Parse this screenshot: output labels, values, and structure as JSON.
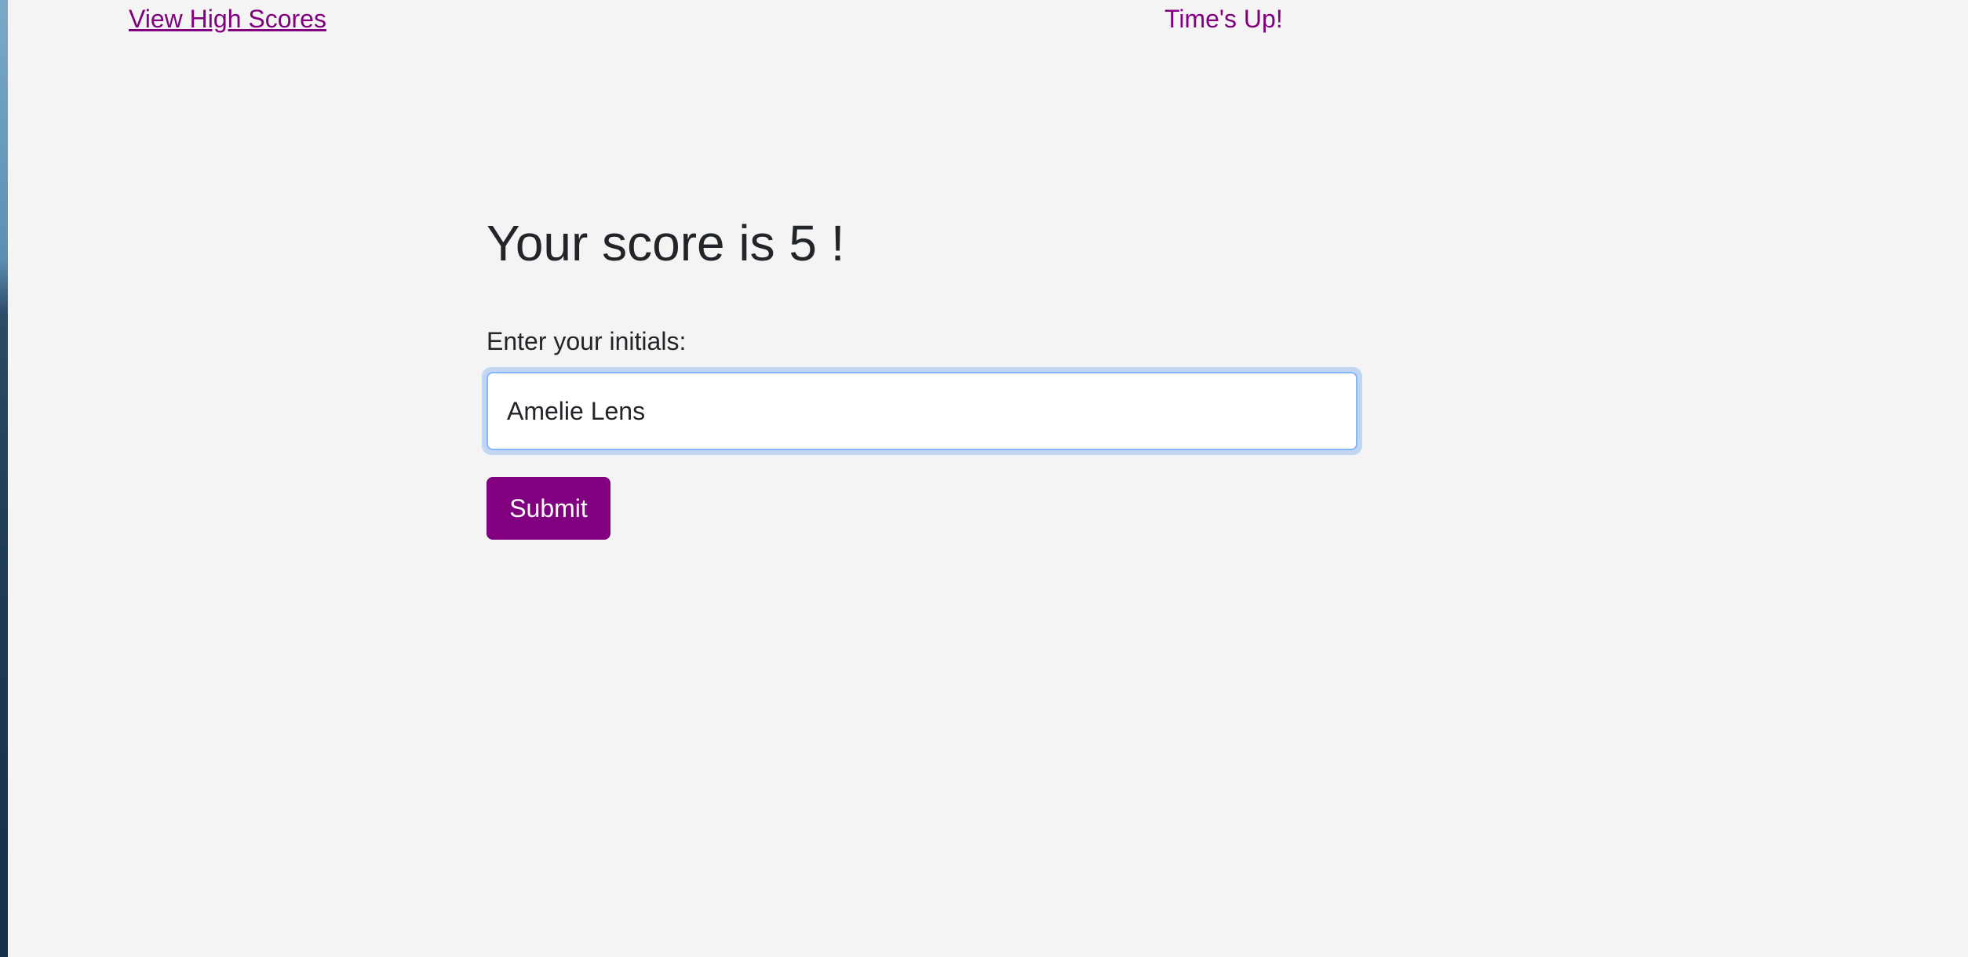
{
  "nav": {
    "high_scores_link": "View High Scores",
    "timer_text": "Time's Up!"
  },
  "result": {
    "heading": "Your score is 5 !"
  },
  "form": {
    "initials_label": "Enter your initials:",
    "initials_value": "Amelie Lens",
    "submit_label": "Submit"
  },
  "colors": {
    "accent": "#800080",
    "background": "#f4f4f4",
    "text": "#212529",
    "focus_border": "#86b7fe"
  }
}
